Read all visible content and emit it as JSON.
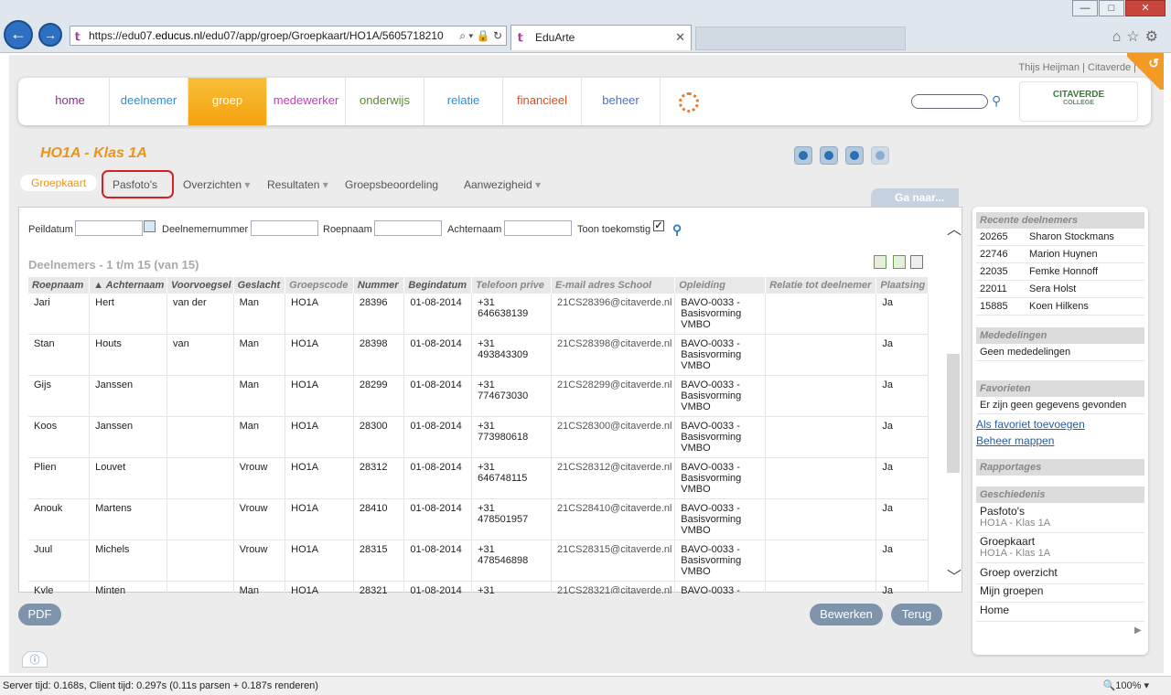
{
  "browser": {
    "url_pre": "https://edu07.",
    "url_bold": "educus.nl",
    "url_post": "/edu07/app/groep/Groepkaart/HO1A/5605718210",
    "url_icons": "⌕ ▾ 🔒 ↻",
    "tab_title": "EduArte",
    "tab_close": "✕",
    "tb_icons": "⌂☆⚙",
    "min": "—",
    "max": "□",
    "close": "✕",
    "back": "←",
    "fwd": "→"
  },
  "user": {
    "text": "Thijs Heijman | Citaverde |"
  },
  "nav": {
    "items": [
      {
        "label": "home",
        "color": "#8a2f8a"
      },
      {
        "label": "deelnemer",
        "color": "#2a8fd4"
      },
      {
        "label": "groep",
        "color": "#ffffff"
      },
      {
        "label": "medewerker",
        "color": "#c43bbd"
      },
      {
        "label": "onderwijs",
        "color": "#5a8b2c"
      },
      {
        "label": "relatie",
        "color": "#2a8fd4"
      },
      {
        "label": "financieel",
        "color": "#d8501f"
      },
      {
        "label": "beheer",
        "color": "#4f6fc4"
      }
    ],
    "logo": "CITAVERDE",
    "logo_sub": "COLLEGE"
  },
  "page": {
    "title": "HO1A - Klas 1A"
  },
  "subnav": {
    "groepkaart": "Groepkaart",
    "pasfotos": "Pasfoto's",
    "overzichten": "Overzichten",
    "resultaten": "Resultaten",
    "groepsbeoordeling": "Groepsbeoordeling",
    "aanwezigheid": "Aanwezigheid",
    "caret": "▾",
    "ganaar": "Ga naar..."
  },
  "filter": {
    "peildatum": "Peildatum",
    "deelnemernummer": "Deelnemernummer",
    "roepnaam": "Roepnaam",
    "achternaam": "Achternaam",
    "toon": "Toon toekomstig",
    "check": "✓",
    "search": "⚲"
  },
  "list": {
    "title": "Deelnemers - 1 t/m 15 (van 15)",
    "columns": [
      "Roepnaam",
      "▲ Achternaam",
      "Voorvoegsel",
      "Geslacht",
      "Groepscode",
      "Nummer",
      "Begindatum",
      "Telefoon prive",
      "E-mail adres School",
      "Opleiding",
      "Relatie tot deelnemer",
      "Plaatsing"
    ],
    "rows": [
      [
        "Jari",
        "Hert",
        "van der",
        "Man",
        "HO1A",
        "28396",
        "01-08-2014",
        "+31 646638139",
        "21CS28396@citaverde.nl",
        "BAVO-0033 - Basisvorming VMBO",
        "",
        "Ja"
      ],
      [
        "Stan",
        "Houts",
        "van",
        "Man",
        "HO1A",
        "28398",
        "01-08-2014",
        "+31 493843309",
        "21CS28398@citaverde.nl",
        "BAVO-0033 - Basisvorming VMBO",
        "",
        "Ja"
      ],
      [
        "Gijs",
        "Janssen",
        "",
        "Man",
        "HO1A",
        "28299",
        "01-08-2014",
        "+31 774673030",
        "21CS28299@citaverde.nl",
        "BAVO-0033 - Basisvorming VMBO",
        "",
        "Ja"
      ],
      [
        "Koos",
        "Janssen",
        "",
        "Man",
        "HO1A",
        "28300",
        "01-08-2014",
        "+31 773980618",
        "21CS28300@citaverde.nl",
        "BAVO-0033 - Basisvorming VMBO",
        "",
        "Ja"
      ],
      [
        "Plien",
        "Louvet",
        "",
        "Vrouw",
        "HO1A",
        "28312",
        "01-08-2014",
        "+31 646748115",
        "21CS28312@citaverde.nl",
        "BAVO-0033 - Basisvorming VMBO",
        "",
        "Ja"
      ],
      [
        "Anouk",
        "Martens",
        "",
        "Vrouw",
        "HO1A",
        "28410",
        "01-08-2014",
        "+31 478501957",
        "21CS28410@citaverde.nl",
        "BAVO-0033 - Basisvorming VMBO",
        "",
        "Ja"
      ],
      [
        "Juul",
        "Michels",
        "",
        "Vrouw",
        "HO1A",
        "28315",
        "01-08-2014",
        "+31 478546898",
        "21CS28315@citaverde.nl",
        "BAVO-0033 - Basisvorming VMBO",
        "",
        "Ja"
      ],
      [
        "Kyle",
        "Minten",
        "",
        "Man",
        "HO1A",
        "28321",
        "01-08-2014",
        "+31",
        "21CS28321@citaverde.nl",
        "BAVO-0033 -",
        "",
        "Ja"
      ]
    ],
    "scroll_up": "︿",
    "scroll_down": "﹀"
  },
  "buttons": {
    "pdf": "PDF",
    "bewerken": "Bewerken",
    "terug": "Terug",
    "info": "ⓘ"
  },
  "sidebar": {
    "recent_title": "Recente deelnemers",
    "recent": [
      {
        "nr": "20265",
        "name": "Sharon Stockmans"
      },
      {
        "nr": "22746",
        "name": "Marion Huynen"
      },
      {
        "nr": "22035",
        "name": "Femke Honnoff"
      },
      {
        "nr": "22011",
        "name": "Sera Holst"
      },
      {
        "nr": "15885",
        "name": "Koen Hilkens"
      }
    ],
    "mededelingen_title": "Mededelingen",
    "mededelingen": "Geen mededelingen",
    "favorieten_title": "Favorieten",
    "favorieten": "Er zijn geen gegevens gevonden",
    "link_toevoegen": "Als favoriet toevoegen",
    "link_mappen": "Beheer mappen",
    "rapportages_title": "Rapportages",
    "geschiedenis_title": "Geschiedenis",
    "history": [
      {
        "label": "Pasfoto's",
        "sub": "HO1A - Klas 1A"
      },
      {
        "label": "Groepkaart",
        "sub": "HO1A - Klas 1A"
      },
      {
        "label": "Groep overzicht",
        "sub": ""
      },
      {
        "label": "Mijn groepen",
        "sub": ""
      },
      {
        "label": "Home",
        "sub": ""
      }
    ],
    "arrow": "▶"
  },
  "status": {
    "text": "Server tijd: 0.168s, Client tijd: 0.297s (0.11s parsen + 0.187s renderen)",
    "zoom": "🔍100%  ▾"
  }
}
